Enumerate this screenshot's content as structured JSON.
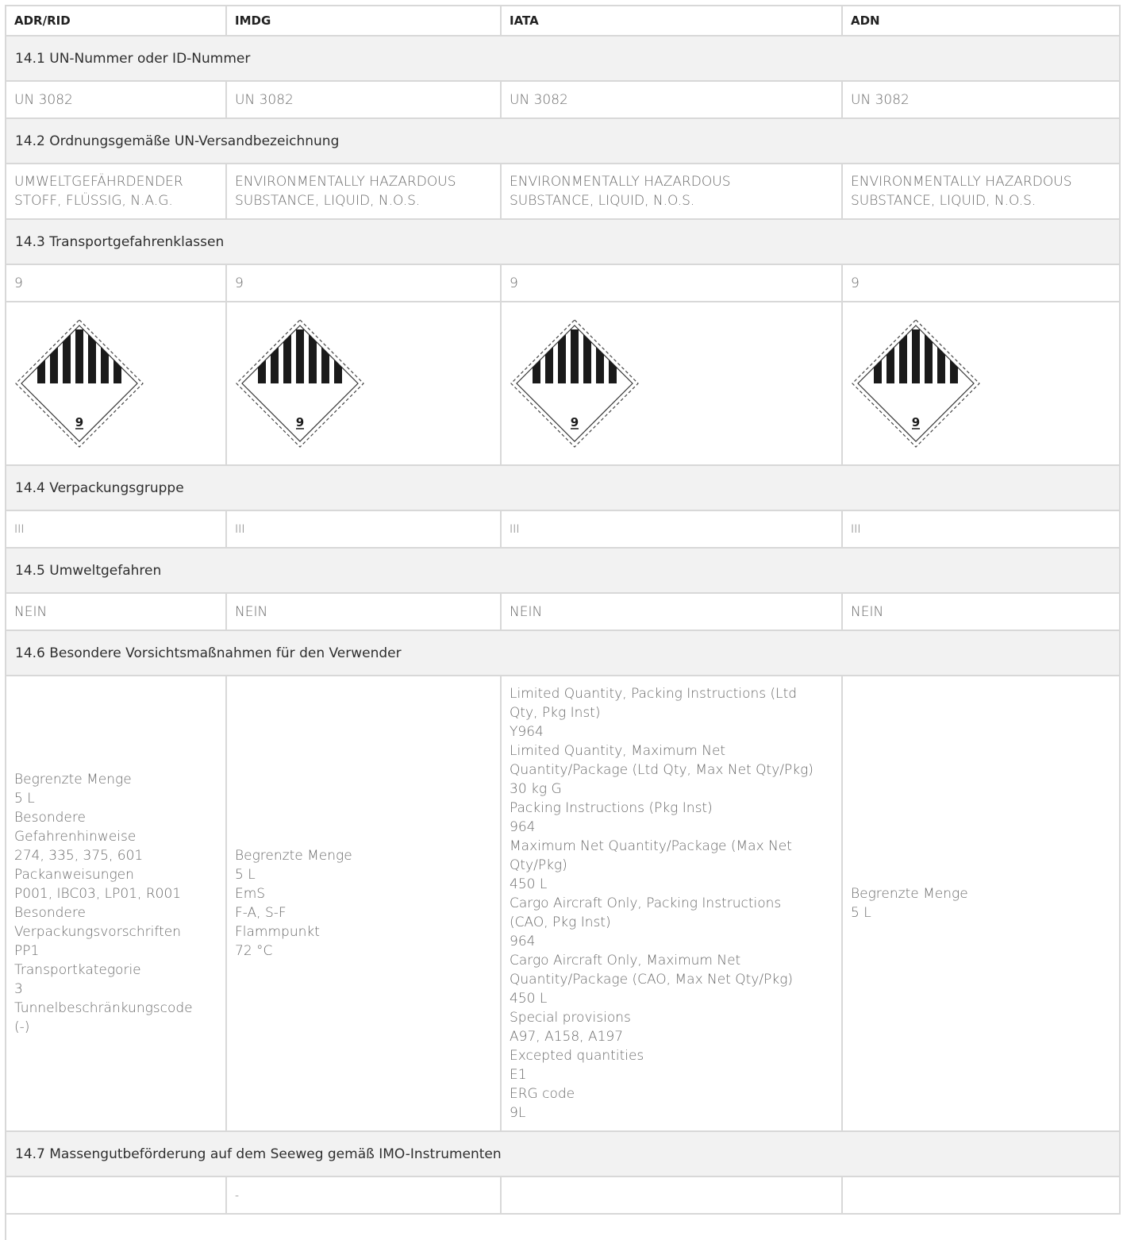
{
  "header": {
    "columns": [
      "ADR/RID",
      "IMDG",
      "IATA",
      "ADN"
    ]
  },
  "sections": {
    "s141": {
      "title": "14.1 UN-Nummer oder ID-Nummer",
      "values": [
        "UN 3082",
        "UN 3082",
        "UN 3082",
        "UN 3082"
      ]
    },
    "s142": {
      "title": "14.2 Ordnungsgemäße UN-Versandbezeichnung",
      "values": [
        [
          "UMWELTGEFÄHRDENDER",
          "STOFF, FLÜSSIG, N.A.G."
        ],
        [
          "ENVIRONMENTALLY HAZARDOUS",
          "SUBSTANCE, LIQUID, N.O.S."
        ],
        [
          "ENVIRONMENTALLY HAZARDOUS",
          "SUBSTANCE, LIQUID, N.O.S."
        ],
        [
          "ENVIRONMENTALLY HAZARDOUS",
          "SUBSTANCE, LIQUID, N.O.S."
        ]
      ]
    },
    "s143": {
      "title": "14.3 Transportgefahrenklassen",
      "values": [
        "9",
        "9",
        "9",
        "9"
      ],
      "placard_icon": "class-9-hazard-placard-icon",
      "placard_number": "9"
    },
    "s144": {
      "title": "14.4 Verpackungsgruppe",
      "values": [
        "III",
        "III",
        "III",
        "III"
      ]
    },
    "s145": {
      "title": "14.5 Umweltgefahren",
      "values": [
        "NEIN",
        "NEIN",
        "NEIN",
        "NEIN"
      ]
    },
    "s146": {
      "title": "14.6 Besondere Vorsichtsmaßnahmen für den Verwender",
      "values": [
        [
          "Begrenzte Menge",
          "5 L",
          "Besondere",
          "Gefahrenhinweise",
          "274, 335, 375, 601",
          "Packanweisungen",
          "P001, IBC03, LP01, R001",
          "Besondere",
          "Verpackungsvorschriften",
          "PP1",
          "Transportkategorie",
          "3",
          "Tunnelbeschränkungscode",
          "(-)"
        ],
        [
          "Begrenzte Menge",
          "5 L",
          "EmS",
          "F-A, S-F",
          "Flammpunkt",
          "72 °C"
        ],
        [
          "Limited Quantity, Packing Instructions (Ltd",
          "Qty, Pkg Inst)",
          "Y964",
          "Limited Quantity, Maximum Net",
          "Quantity/Package (Ltd Qty, Max Net Qty/Pkg)",
          "30 kg G",
          "Packing Instructions (Pkg Inst)",
          "964",
          "Maximum Net Quantity/Package (Max Net",
          "Qty/Pkg)",
          "450 L",
          "Cargo Aircraft Only, Packing Instructions",
          "(CAO, Pkg Inst)",
          "964",
          "Cargo Aircraft Only, Maximum Net",
          "Quantity/Package (CAO, Max Net Qty/Pkg)",
          "450 L",
          "Special provisions",
          "A97, A158, A197",
          "Excepted quantities",
          "E1",
          "ERG code",
          "9L"
        ],
        [
          "Begrenzte Menge",
          "5 L"
        ]
      ]
    },
    "s147": {
      "title": "14.7 Massengutbeförderung auf dem Seeweg gemäß IMO-Instrumenten",
      "values": [
        "",
        "-",
        "",
        ""
      ]
    }
  }
}
